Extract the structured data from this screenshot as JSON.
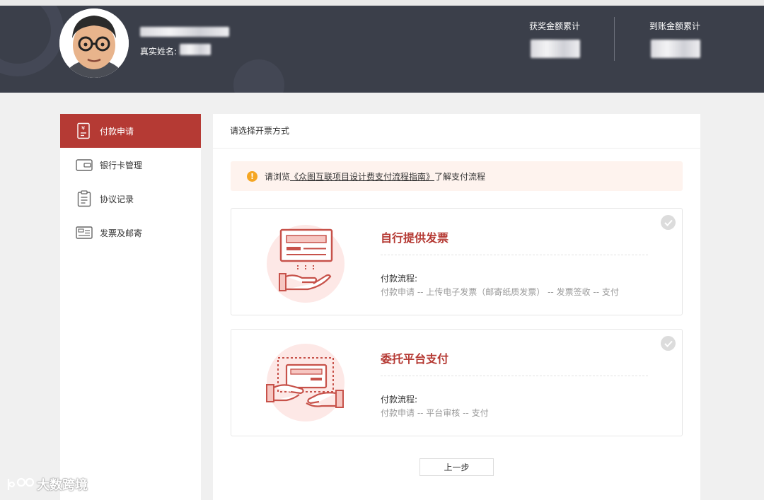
{
  "profile": {
    "real_name_label": "真实姓名:"
  },
  "stats": {
    "awards_total_label": "获奖金额累计",
    "received_total_label": "到账金额累计"
  },
  "sidebar": {
    "items": [
      {
        "label": "付款申请",
        "icon": "payment-request-icon",
        "active": true
      },
      {
        "label": "银行卡管理",
        "icon": "wallet-icon",
        "active": false
      },
      {
        "label": "协议记录",
        "icon": "clipboard-icon",
        "active": false
      },
      {
        "label": "发票及邮寄",
        "icon": "invoice-icon",
        "active": false
      }
    ]
  },
  "main": {
    "title": "请选择开票方式",
    "notice": {
      "prefix": "请浏览",
      "link": "《众图互联项目设计费支付流程指南》",
      "suffix": "了解支付流程"
    },
    "options": [
      {
        "title": "自行提供发票",
        "flow_label": "付款流程:",
        "flow": "付款申请 -- 上传电子发票（邮寄纸质发票） -- 发票签收 -- 支付"
      },
      {
        "title": "委托平台支付",
        "flow_label": "付款流程:",
        "flow": "付款申请 -- 平台审核 -- 支付"
      }
    ],
    "prev_button": "上一步"
  },
  "watermark": "大数跨境",
  "colors": {
    "header_bg": "#3b3f4a",
    "accent": "#b53a34",
    "notice_bg": "#fef3ee",
    "warn": "#f5a623"
  }
}
